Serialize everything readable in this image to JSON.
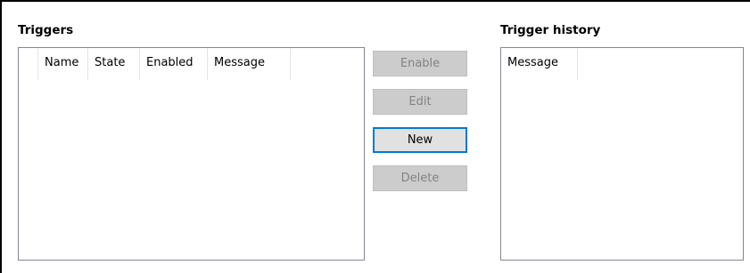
{
  "triggers": {
    "title": "Triggers",
    "columns": [
      "",
      "Name",
      "State",
      "Enabled",
      "Message"
    ]
  },
  "buttons": {
    "enable": "Enable",
    "edit": "Edit",
    "new": "New",
    "delete": "Delete"
  },
  "history": {
    "title": "Trigger history",
    "columns": [
      "Message"
    ]
  }
}
